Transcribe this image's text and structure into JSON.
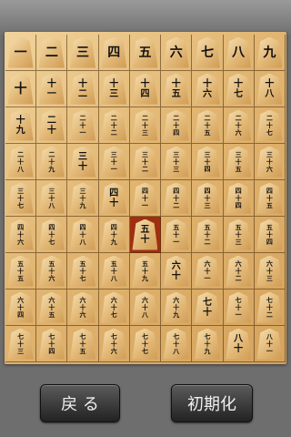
{
  "board": {
    "selected": {
      "row": 5,
      "col": 4
    },
    "cells": [
      [
        "一",
        "二",
        "三",
        "四",
        "五",
        "六",
        "七",
        "八",
        "九"
      ],
      [
        "十",
        "十一",
        "十二",
        "十三",
        "十四",
        "十五",
        "十六",
        "十七",
        "十八"
      ],
      [
        "十九",
        "二十",
        "二十一",
        "二十二",
        "二十三",
        "二十四",
        "二十五",
        "二十六",
        "二十七"
      ],
      [
        "二十八",
        "二十九",
        "三十",
        "三十一",
        "三十二",
        "三十三",
        "三十四",
        "三十五",
        "三十六"
      ],
      [
        "三十七",
        "三十八",
        "三十九",
        "四十",
        "四十一",
        "四十二",
        "四十三",
        "四十四",
        "四十五"
      ],
      [
        "四十六",
        "四十七",
        "四十八",
        "四十九",
        "五十",
        "五十一",
        "五十二",
        "五十三",
        "五十四"
      ],
      [
        "五十五",
        "五十六",
        "五十七",
        "五十八",
        "五十九",
        "六十",
        "六十一",
        "六十二",
        "六十三"
      ],
      [
        "六十四",
        "六十五",
        "六十六",
        "六十七",
        "六十八",
        "六十九",
        "七十",
        "七十一",
        "七十二"
      ],
      [
        "七十三",
        "七十四",
        "七十五",
        "七十六",
        "七十七",
        "七十八",
        "七十九",
        "八十",
        "八十一"
      ]
    ]
  },
  "controls": {
    "back_label": "戻 る",
    "reset_label": "初期化"
  }
}
